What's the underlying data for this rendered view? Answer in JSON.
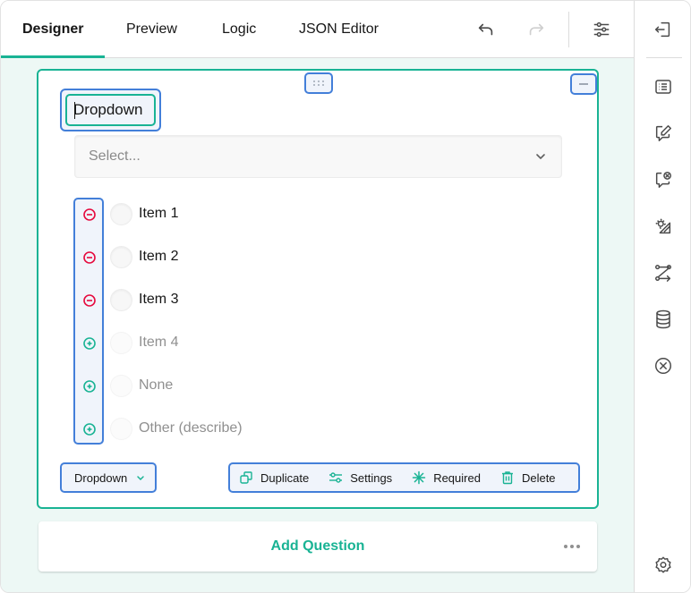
{
  "tabs": [
    {
      "label": "Designer",
      "active": true
    },
    {
      "label": "Preview",
      "active": false
    },
    {
      "label": "Logic",
      "active": false
    },
    {
      "label": "JSON Editor",
      "active": false
    }
  ],
  "toolbar": {
    "icons": [
      "undo-icon",
      "redo-icon",
      "settings-sliders-icon"
    ],
    "redo_disabled": true
  },
  "sidebar": {
    "icons": [
      "exit-panel-icon",
      "list-icon",
      "edit-comment-icon",
      "comment-x-icon",
      "theme-icon",
      "logic-flow-icon",
      "database-icon",
      "clear-icon",
      "gear-icon"
    ]
  },
  "question": {
    "title": "Dropdown",
    "placeholder": "Select...",
    "choices": [
      {
        "label": "Item 1",
        "enabled": true,
        "action": "remove"
      },
      {
        "label": "Item 2",
        "enabled": true,
        "action": "remove"
      },
      {
        "label": "Item 3",
        "enabled": true,
        "action": "remove"
      },
      {
        "label": "Item 4",
        "enabled": false,
        "action": "add"
      },
      {
        "label": "None",
        "enabled": false,
        "action": "add"
      },
      {
        "label": "Other (describe)",
        "enabled": false,
        "action": "add"
      }
    ],
    "type_selector": "Dropdown",
    "actions": {
      "duplicate": "Duplicate",
      "settings": "Settings",
      "required": "Required",
      "delete": "Delete"
    }
  },
  "add_question": {
    "label": "Add Question"
  },
  "colors": {
    "accent": "#19b394",
    "selection": "#437fd9",
    "remove": "#e60a3e",
    "canvas_bg": "#edf8f5"
  }
}
